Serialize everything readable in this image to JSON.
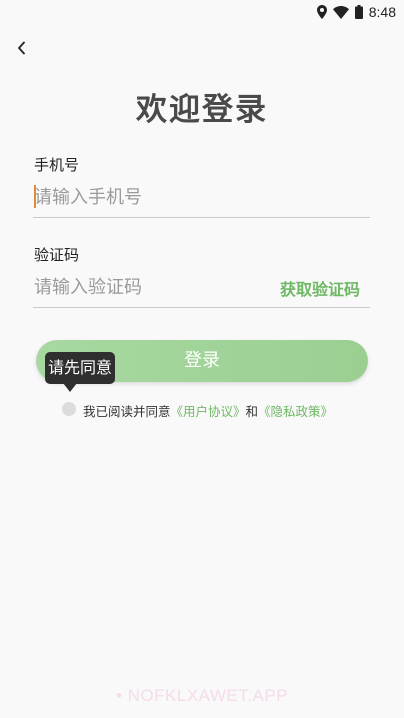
{
  "status_bar": {
    "time": "8:48",
    "icons": [
      "location-icon",
      "wifi-icon",
      "battery-icon"
    ]
  },
  "header": {
    "back_icon": "chevron-left-icon",
    "title": "欢迎登录"
  },
  "form": {
    "phone": {
      "label": "手机号",
      "placeholder": "请输入手机号",
      "value": ""
    },
    "code": {
      "label": "验证码",
      "placeholder": "请输入验证码",
      "value": "",
      "get_code_label": "获取验证码"
    },
    "login_label": "登录"
  },
  "tooltip": {
    "text": "请先同意"
  },
  "agreement": {
    "checked": false,
    "prefix": "我已阅读并同意",
    "user_agreement": "《用户协议》",
    "joiner": "和",
    "privacy_policy": "《隐私政策》"
  },
  "watermark": "• NOFKLXAWET.APP",
  "colors": {
    "accent": "#6fb865",
    "button": "#a7d8a1",
    "background": "#f9f9f9",
    "tooltip": "#2f2f2f"
  }
}
